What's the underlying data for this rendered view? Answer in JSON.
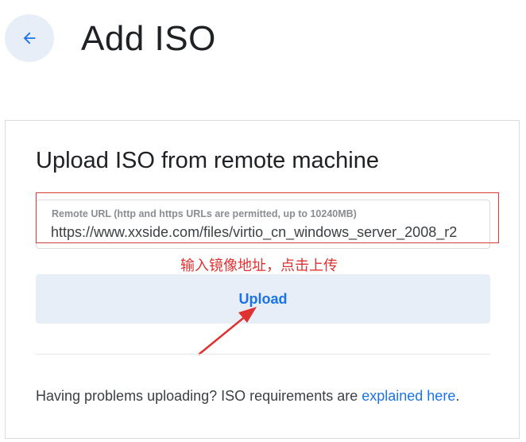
{
  "header": {
    "back_icon": "arrow-left-icon",
    "title": "Add ISO"
  },
  "card": {
    "title": "Upload ISO from remote machine",
    "url_field": {
      "label": "Remote URL (http and https URLs are permitted, up to 10240MB)",
      "value": "https://www.xxside.com/files/virtio_cn_windows_server_2008_r2"
    },
    "annotation": "输入镜像地址，点击上传",
    "upload_label": "Upload",
    "help": {
      "text": "Having problems uploading? ISO requirements are ",
      "link": "explained here",
      "suffix": "."
    }
  },
  "colors": {
    "accent": "#1a73e8",
    "button_bg": "#e8eef8",
    "annotation_red": "#e03131"
  }
}
